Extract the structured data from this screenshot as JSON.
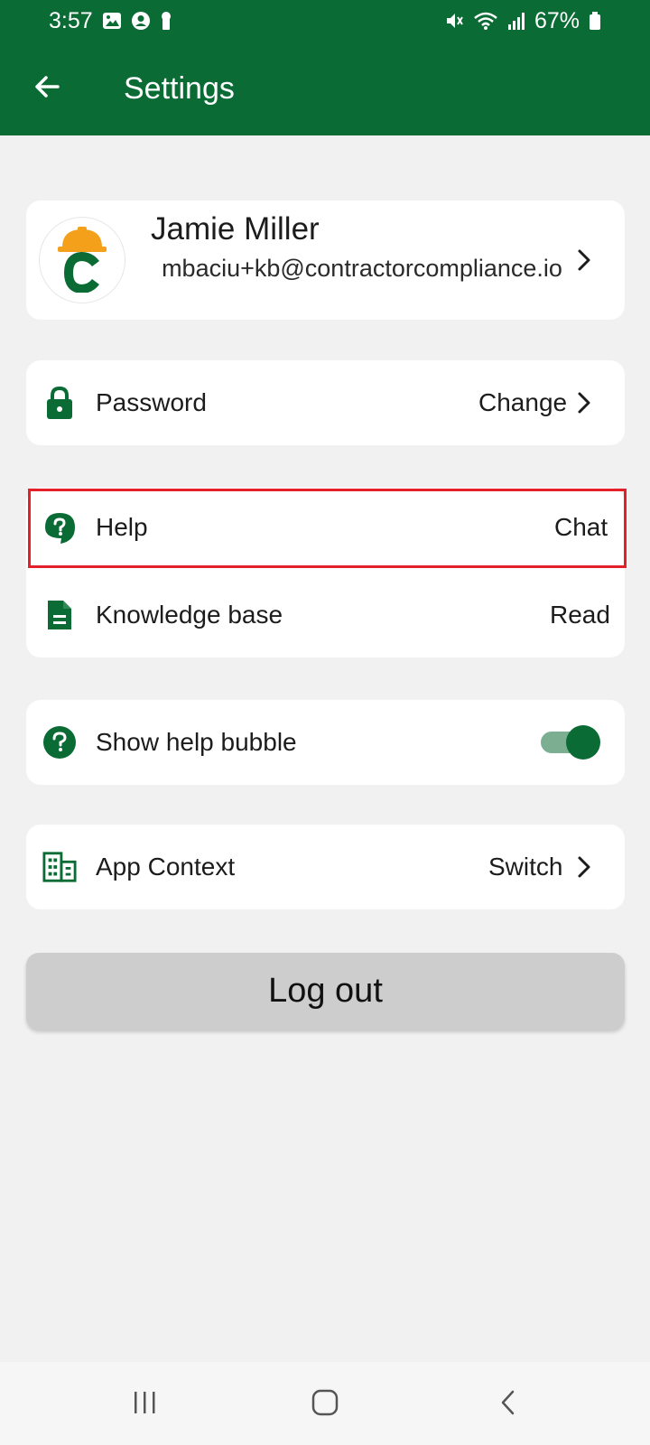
{
  "status_bar": {
    "time": "3:57",
    "battery": "67%",
    "icons": [
      "image-icon",
      "account-circle-icon",
      "keyhole-icon",
      "mute-icon",
      "wifi-icon",
      "signal-icon",
      "battery-icon"
    ]
  },
  "app_bar": {
    "title": "Settings",
    "back_icon": "arrow-left-icon"
  },
  "profile": {
    "name": "Jamie Miller",
    "email": "mbaciu+kb@contractorcompliance.io",
    "avatar_icon": "hardhat-c-logo"
  },
  "password_row": {
    "label": "Password",
    "value": "Change",
    "icon": "lock-icon"
  },
  "help_rows": [
    {
      "label": "Help",
      "value": "Chat",
      "icon": "help-chat-icon"
    },
    {
      "label": "Knowledge base",
      "value": "Read",
      "icon": "document-icon"
    }
  ],
  "bubble_row": {
    "label": "Show help bubble",
    "icon": "help-circle-icon",
    "enabled": true
  },
  "context_row": {
    "label": "App Context",
    "value": "Switch",
    "icon": "building-icon"
  },
  "logout_label": "Log out",
  "colors": {
    "brand_green": "#0b6b35",
    "toggle_track": "#7cae92",
    "highlight": "#e4202a",
    "logo_orange": "#f5a01a"
  }
}
